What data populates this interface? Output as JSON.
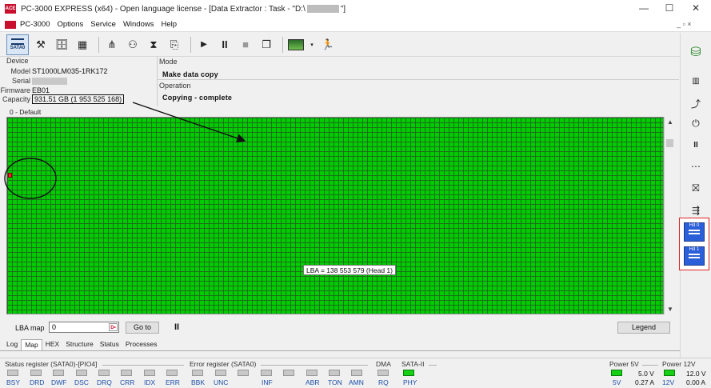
{
  "window": {
    "title_prefix": "PC-3000 EXPRESS (x64) - Open language license - [Data Extractor : Task - \"D:\\",
    "title_suffix": "\"]",
    "logo_text": "ACE",
    "minimize": "—",
    "maximize": "☐",
    "close": "✕"
  },
  "menu": {
    "items": [
      "PC-3000",
      "Options",
      "Service",
      "Windows",
      "Help"
    ],
    "mdi_controls": "_ ▫ ×"
  },
  "toolbar": {
    "sata_label": "SATA0"
  },
  "device": {
    "header": "Device",
    "model_label": "Model",
    "model_value": "ST1000LM035-1RK172",
    "serial_label": "Serial",
    "firmware_label": "Firmware",
    "firmware_value": "EB01",
    "capacity_label": "Capacity",
    "capacity_value": "931.51 GB (1 953 525 168)"
  },
  "mode": {
    "header": "Mode",
    "value": "Make data copy",
    "operation_header": "Operation",
    "operation_value": "Copying - complete"
  },
  "map": {
    "section_label": "0 - Default",
    "tooltip": "LBA =  138 553 579 (Head 1)",
    "cell_color": "#00cc00",
    "grid_color": "#1e6e1e",
    "bad_color": "#ff2020"
  },
  "lba_controls": {
    "label": "LBA map",
    "value": "0",
    "hex_badge": "D•",
    "goto": "Go to",
    "pause": "II",
    "legend": "Legend"
  },
  "tabs": [
    "Log",
    "Map",
    "HEX",
    "Structure",
    "Status",
    "Processes"
  ],
  "active_tab": "Map",
  "status": {
    "status_register_title": "Status register (SATA0)-[PIO4]",
    "status_bits": [
      "BSY",
      "DRD",
      "DWF",
      "DSC",
      "DRQ",
      "CRR",
      "IDX",
      "ERR"
    ],
    "error_register_title": "Error register (SATA0)",
    "error_bits": [
      "BBK",
      "UNC",
      "",
      "INF",
      "",
      "ABR",
      "TON",
      "AMN"
    ],
    "dma_title": "DMA",
    "dma_bits": [
      "RQ"
    ],
    "sata_title": "SATA-II",
    "sata_bits": [
      "PHY"
    ],
    "power5_title": "Power 5V",
    "power5_led": "5V",
    "power5_voltage": "5.0 V",
    "power5_current": "0.27 A",
    "power12_title": "Power 12V",
    "power12_led": "12V",
    "power12_voltage": "12.0 V",
    "power12_current": "0.00 A",
    "led_on_color": "#16d016",
    "led_off_color": "#c8c8c8"
  },
  "right_toolbar": {
    "hd0_label": "Hd 0",
    "hd1_label": "Hd 1",
    "highlight_color": "#e02020"
  }
}
